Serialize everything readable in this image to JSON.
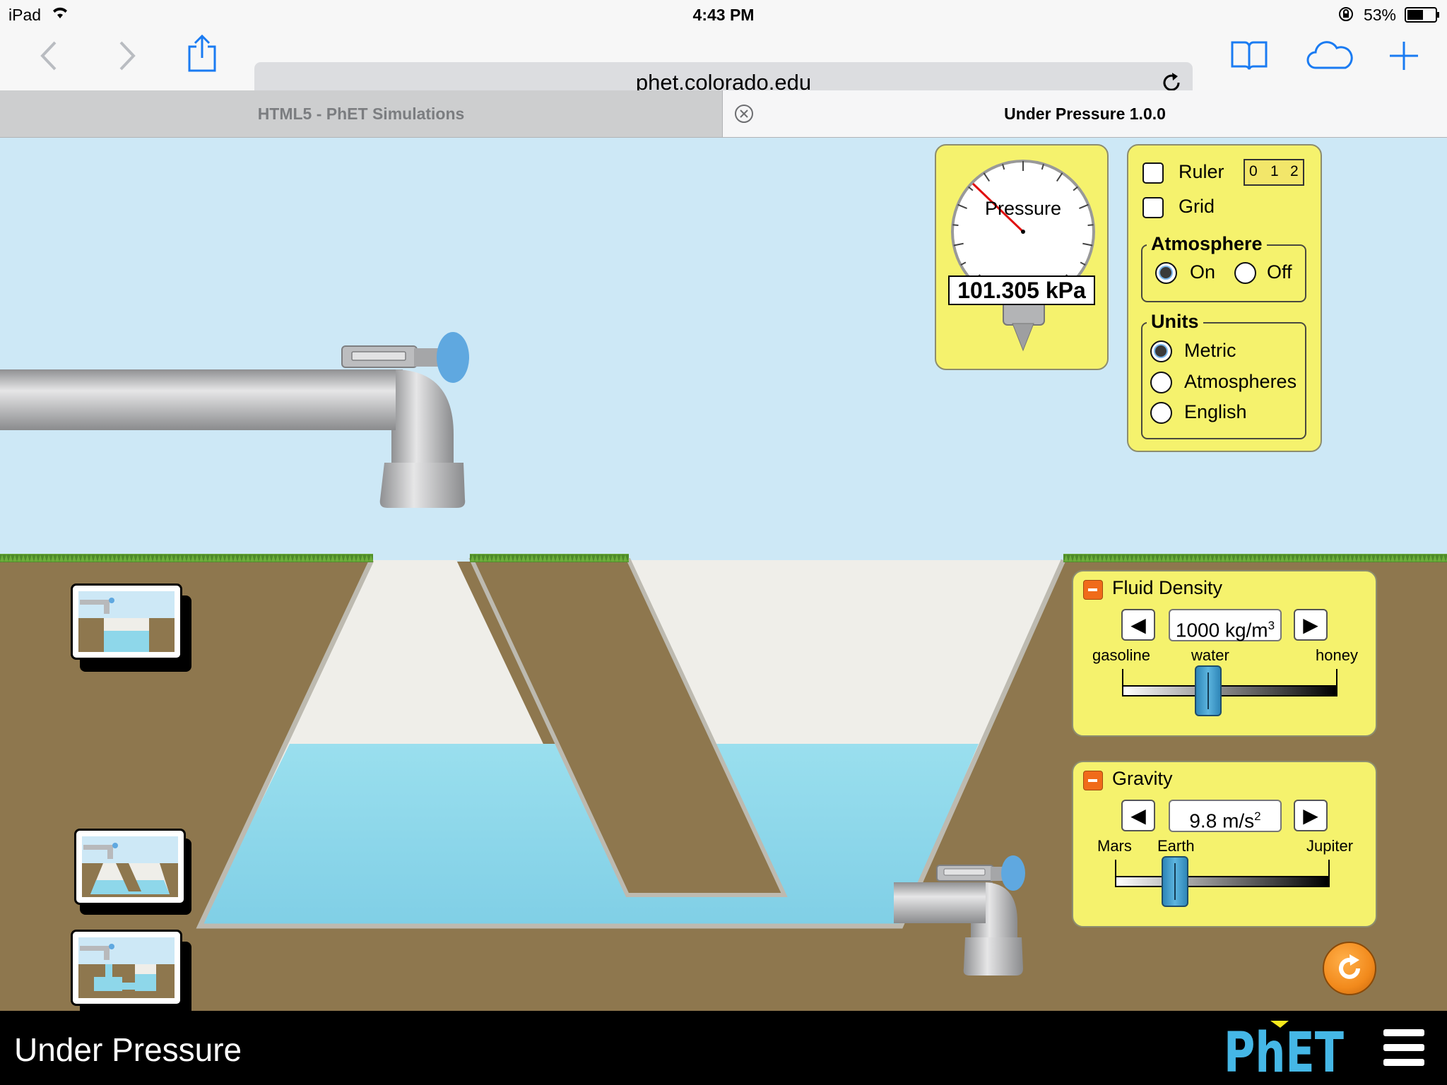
{
  "status": {
    "carrier": "iPad",
    "time": "4:43 PM",
    "battery": "53%"
  },
  "browser": {
    "url": "phet.colorado.edu",
    "tabs": [
      {
        "label": "HTML5 - PhET Simulations"
      },
      {
        "label": "Under Pressure 1.0.0"
      }
    ]
  },
  "gauge": {
    "label": "Pressure",
    "value": "101.305 kPa"
  },
  "controls": {
    "ruler_label": "Ruler",
    "ruler_ticks": [
      "0",
      "1",
      "2"
    ],
    "grid_label": "Grid",
    "atmosphere_title": "Atmosphere",
    "atmosphere_on": "On",
    "atmosphere_off": "Off",
    "atmosphere_selected": "On",
    "units_title": "Units",
    "units_options": [
      "Metric",
      "Atmospheres",
      "English"
    ],
    "units_selected": "Metric"
  },
  "fluid_density": {
    "title": "Fluid Density",
    "value": "1000 kg/m",
    "unit_sup": "3",
    "labels": [
      "gasoline",
      "water",
      "honey"
    ],
    "level_fraction": 0.4
  },
  "gravity": {
    "title": "Gravity",
    "value": "9.8 m/s",
    "unit_sup": "2",
    "labels": [
      "Mars",
      "Earth",
      "Jupiter"
    ],
    "level_fraction": 0.28
  },
  "scene_buttons": [
    {
      "name": "square-pool"
    },
    {
      "name": "trapezoid-pool"
    },
    {
      "name": "chamber-pool"
    },
    {
      "name": "mystery-pool",
      "label": "?"
    }
  ],
  "footer": {
    "title": "Under Pressure",
    "logo_text": "PhET"
  },
  "colors": {
    "sky": "#cde8f6",
    "ground": "#8e774e",
    "water": "#8ed7ea",
    "panel": "#f5f26d",
    "slider_thumb": "#3a94c6",
    "reset": "#f28a1c"
  }
}
